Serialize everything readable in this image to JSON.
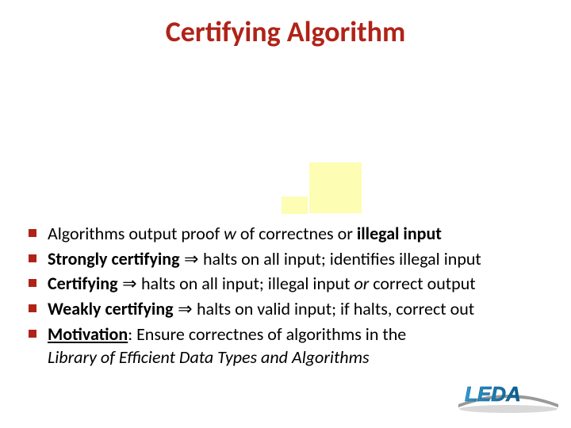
{
  "title": "Certifying Algorithm",
  "bullets": [
    {
      "pre": "Algorithms output proof ",
      "w": "w",
      "post": " of correctnes or ",
      "bold": "illegal input",
      "tail": ""
    },
    {
      "bold": "Strongly certifying",
      "imply": " ⇒ ",
      "post": " halts on all input; identifies illegal input"
    },
    {
      "bold": "Certifying",
      "imply": " ⇒ ",
      "post": "halts on all input; illegal input ",
      "ital": "or",
      "tail": " correct output"
    },
    {
      "bold": "Weakly certifying",
      "imply": " ⇒ ",
      "post": " halts on valid input; if halts, correct out"
    },
    {
      "bold": "Motivation",
      "post": ": Ensure correctnes of algorithms in the",
      "ital_line": "Library of Efficient Data Types and Algorithms"
    }
  ],
  "logo_text": "LEDA"
}
